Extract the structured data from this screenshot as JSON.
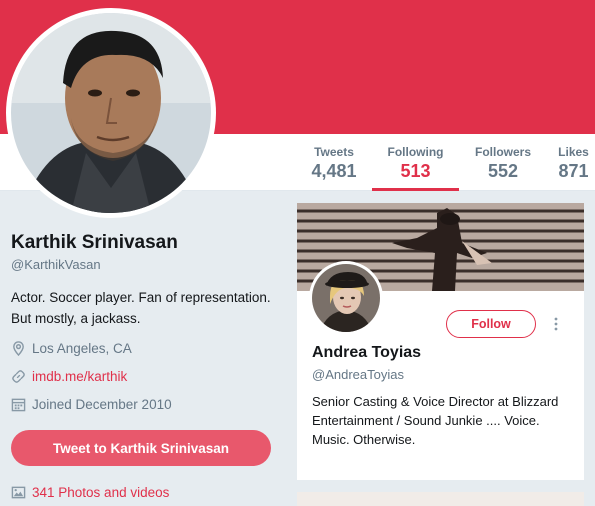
{
  "profile": {
    "name": "Karthik Srinivasan",
    "handle": "@KarthikVasan",
    "bio": "Actor. Soccer player. Fan of representation. But mostly, a jackass.",
    "location": "Los Angeles, CA",
    "website": "imdb.me/karthik",
    "joined": "Joined December 2010",
    "tweet_button": "Tweet to Karthik Srinivasan",
    "photos_link": "341 Photos and videos"
  },
  "stats": [
    {
      "label": "Tweets",
      "value": "4,481",
      "active": false
    },
    {
      "label": "Following",
      "value": "513",
      "active": true
    },
    {
      "label": "Followers",
      "value": "552",
      "active": false
    },
    {
      "label": "Likes",
      "value": "871",
      "active": false
    }
  ],
  "card": {
    "name": "Andrea Toyias",
    "handle": "@AndreaToyias",
    "bio": "Senior Casting & Voice Director at Blizzard Entertainment / Sound Junkie .... Voice. Music. Otherwise.",
    "follow_label": "Follow"
  },
  "colors": {
    "accent": "#e0304a",
    "muted": "#657786",
    "background": "#e6ecf0"
  },
  "icons": [
    "location-pin-icon",
    "link-icon",
    "calendar-icon",
    "photo-icon",
    "more-vertical-icon"
  ]
}
